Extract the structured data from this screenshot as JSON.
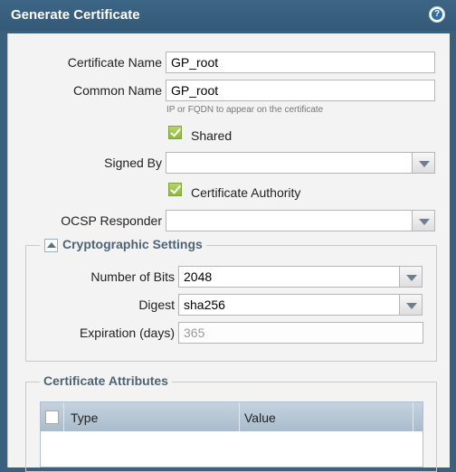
{
  "dialog": {
    "title": "Generate Certificate",
    "help_icon": "help-icon"
  },
  "form": {
    "certificate_name": {
      "label": "Certificate Name",
      "value": "GP_root"
    },
    "common_name": {
      "label": "Common Name",
      "value": "GP_root",
      "hint": "IP or FQDN to appear on the certificate"
    },
    "shared": {
      "label": "Shared",
      "checked": true
    },
    "signed_by": {
      "label": "Signed By",
      "value": ""
    },
    "certificate_authority": {
      "label": "Certificate Authority",
      "checked": true
    },
    "ocsp_responder": {
      "label": "OCSP Responder",
      "value": ""
    }
  },
  "crypto": {
    "legend": "Cryptographic Settings",
    "number_of_bits": {
      "label": "Number of Bits",
      "value": "2048"
    },
    "digest": {
      "label": "Digest",
      "value": "sha256"
    },
    "expiration": {
      "label": "Expiration (days)",
      "value": "365"
    }
  },
  "attributes": {
    "legend": "Certificate Attributes",
    "columns": [
      "Type",
      "Value"
    ]
  },
  "colors": {
    "title_bar": "#39607d",
    "panel": "#f3f3f3",
    "grid_header": "#b3c4d2",
    "checkbox_green": "#9cc24c"
  }
}
